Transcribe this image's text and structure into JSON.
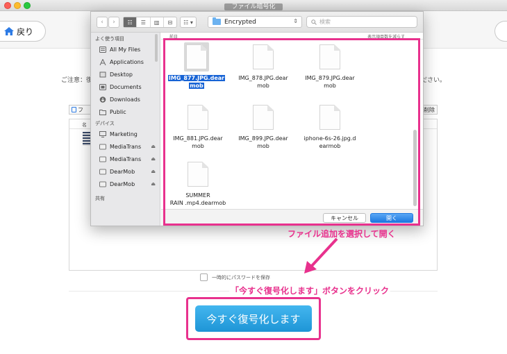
{
  "window": {
    "title": "ファイル暗号化"
  },
  "toolbar": {
    "back_label": "戻り"
  },
  "main": {
    "notice_left": "ご注意：復",
    "notice_right": "ださい。",
    "add_label": "フ",
    "delete_label": "削除",
    "list_header": "名",
    "save_password_label": "一時的にパスワードを保存",
    "decrypt_button": "今すぐ復号化します"
  },
  "dialog": {
    "location": "Encrypted",
    "search_placeholder": "検索",
    "view_modes": [
      "☷",
      "☰",
      "▥",
      "⊟"
    ],
    "arrange_label": "☷ ▾",
    "column_left": "前日",
    "column_right": "表示項目数を減らす",
    "sidebar": {
      "favorites_header": "よく使う項目",
      "favorites": [
        {
          "label": "All My Files",
          "icon": "all-files-icon"
        },
        {
          "label": "Applications",
          "icon": "applications-icon"
        },
        {
          "label": "Desktop",
          "icon": "desktop-icon"
        },
        {
          "label": "Documents",
          "icon": "documents-icon"
        },
        {
          "label": "Downloads",
          "icon": "downloads-icon"
        },
        {
          "label": "Public",
          "icon": "folder-icon"
        }
      ],
      "devices_header": "デバイス",
      "devices": [
        {
          "label": "Marketing",
          "icon": "computer-icon"
        },
        {
          "label": "MediaTrans",
          "icon": "drive-icon"
        },
        {
          "label": "MediaTrans",
          "icon": "drive-icon"
        },
        {
          "label": "DearMob",
          "icon": "drive-icon"
        },
        {
          "label": "DearMob",
          "icon": "drive-icon"
        }
      ],
      "shared_header": "共有"
    },
    "files": [
      {
        "line1": "IMG_877.JPG.dear",
        "line2": "mob",
        "selected": true
      },
      {
        "line1": "IMG_878.JPG.dear",
        "line2": "mob",
        "selected": false
      },
      {
        "line1": "IMG_879.JPG.dear",
        "line2": "mob",
        "selected": false
      },
      {
        "line1": "IMG_881.JPG.dear",
        "line2": "mob",
        "selected": false
      },
      {
        "line1": "IMG_899.JPG.dear",
        "line2": "mob",
        "selected": false
      },
      {
        "line1": "iphone-6s-26.jpg.d",
        "line2": "earmob",
        "selected": false
      },
      {
        "line1": "SUMMER",
        "line2": "RAIN .mp4.dearmob",
        "selected": false
      }
    ],
    "cancel_button": "キャンセル",
    "open_button": "開く"
  },
  "annotations": {
    "open_hint": "ファイル追加を選択して開く",
    "button_hint": "「今すぐ復号化します」ボタンをクリック",
    "accent_color": "#e8318d"
  }
}
